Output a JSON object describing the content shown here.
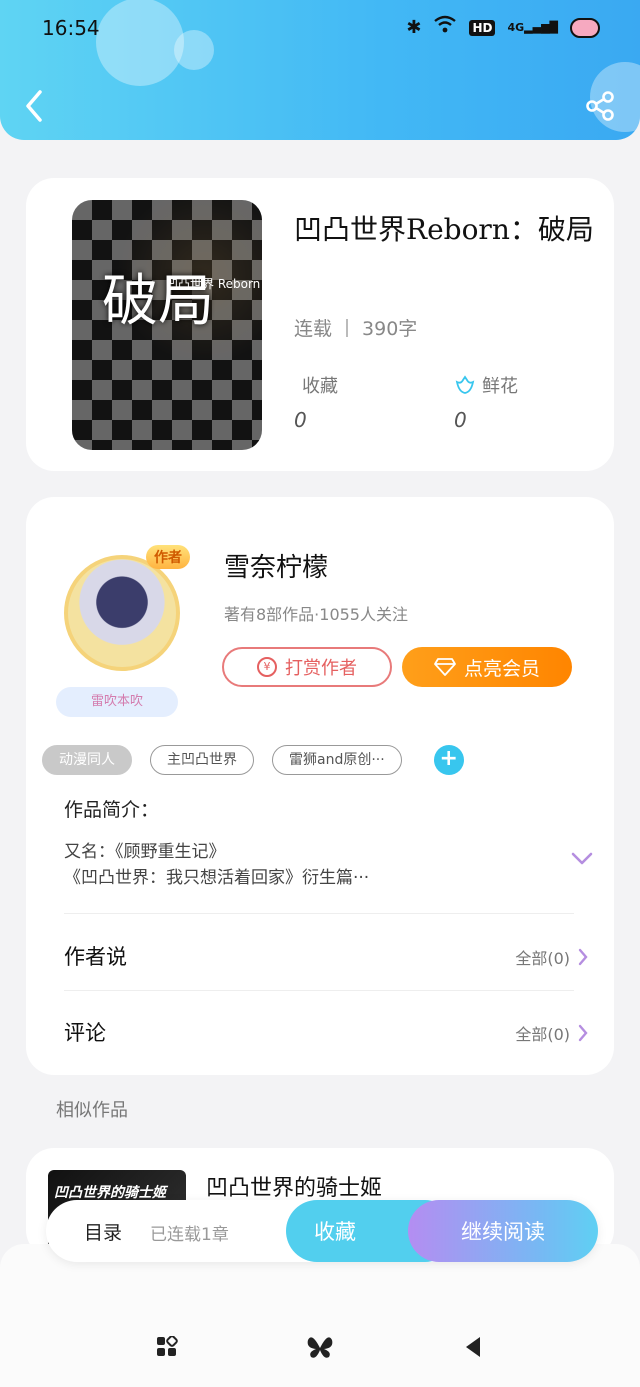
{
  "status_bar": {
    "time": "16:54",
    "network_label": "HD",
    "signal_label": "4G"
  },
  "book": {
    "title": "凹凸世界Reborn：破局",
    "status": "连载",
    "word_count": "390字",
    "cover_text": "破局",
    "cover_subtitle": "凹凸世界 Reborn",
    "favorites_label": "收藏",
    "favorites_value": "0",
    "flowers_label": "鲜花",
    "flowers_value": "0"
  },
  "author": {
    "badge": "作者",
    "name": "雪奈柠檬",
    "info": "著有8部作品·1055人关注",
    "fan_badge": "雷吹本吹",
    "reward_label": "打赏作者",
    "vip_label": "点亮会员"
  },
  "tags": [
    "动漫同人",
    "主凹凸世界",
    "雷狮and原创···"
  ],
  "intro": {
    "heading": "作品简介：",
    "line1": "又名：《顾野重生记》",
    "line2": "《凹凸世界：我只想活着回家》衍生篇···"
  },
  "rows": {
    "author_says": "作者说",
    "author_says_more": "全部(0)",
    "comments": "评论",
    "comments_more": "全部(0)"
  },
  "similar": {
    "heading": "相似作品",
    "title": "凹凸世界的骑士姬",
    "cover_text": "凹凸世界的骑士姬"
  },
  "action_bar": {
    "catalog": "目录",
    "chapters": "已连载1章",
    "favorite": "收藏",
    "continue": "继续阅读"
  },
  "colors": {
    "header_gradient_start": "#5fd4f3",
    "header_gradient_end": "#3aa9f2",
    "accent_orange": "#ff8500",
    "accent_cyan": "#38c6ee",
    "reward_red": "#e56060"
  }
}
